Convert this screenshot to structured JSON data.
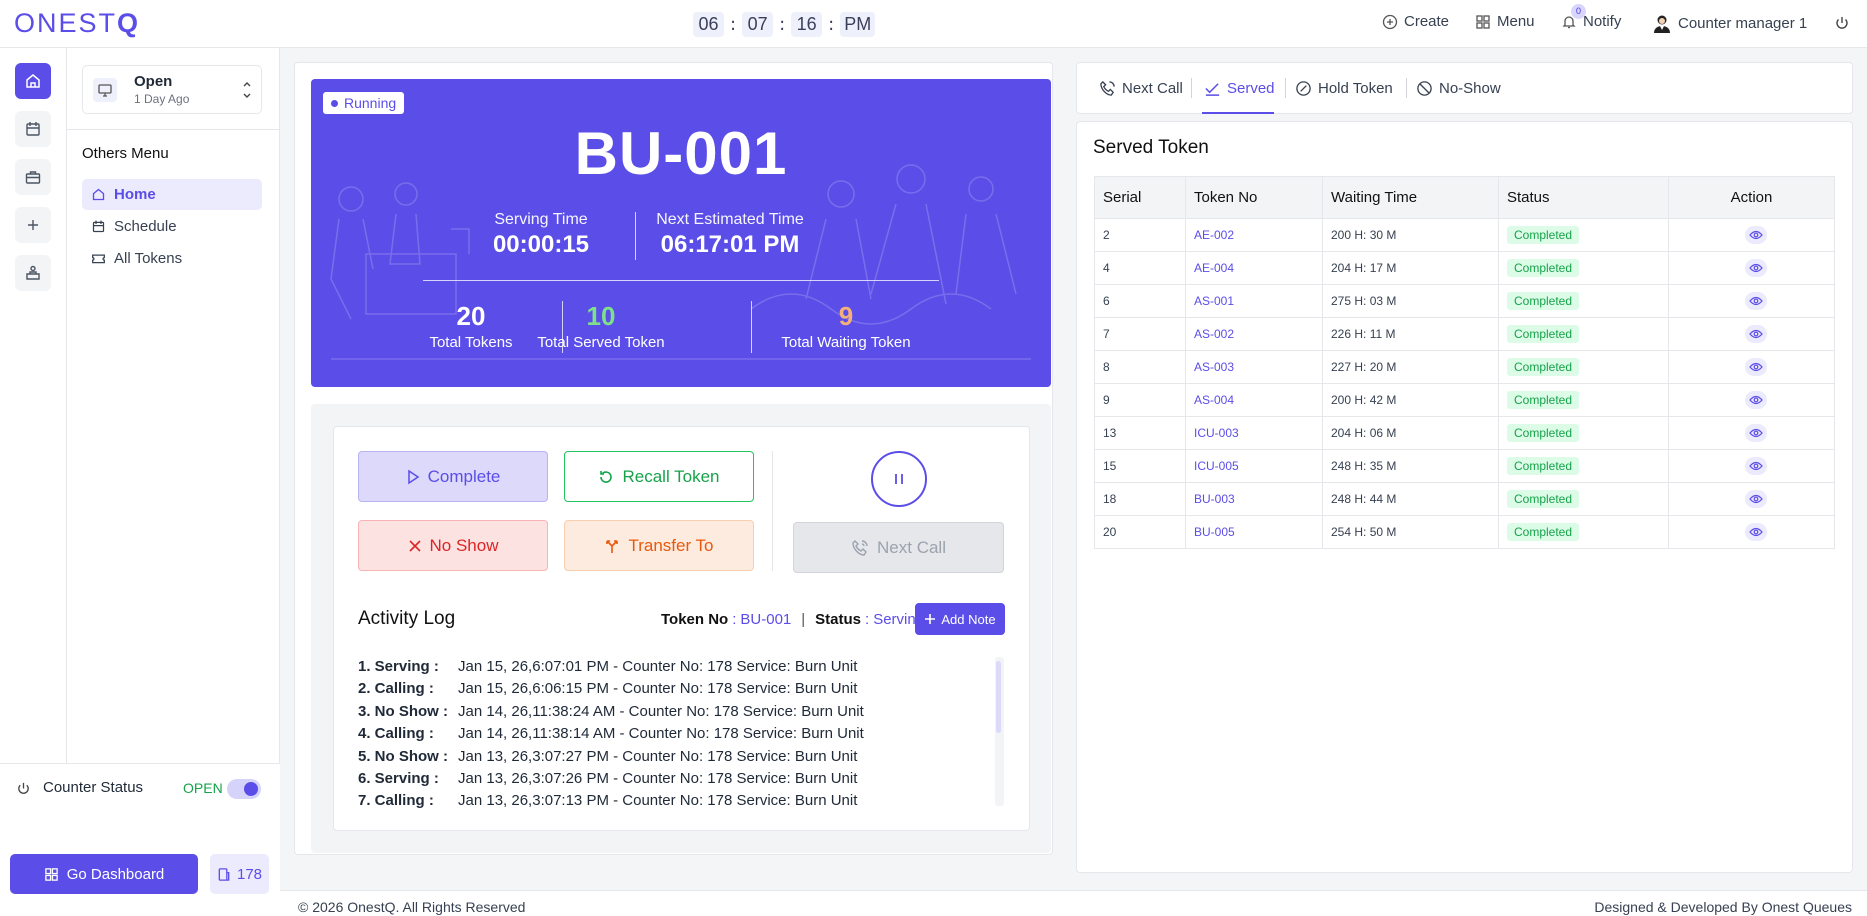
{
  "header": {
    "logo_text": "ONESTQ",
    "clock": {
      "hours": "06",
      "minutes": "07",
      "seconds": "16",
      "period": "PM"
    },
    "create_label": "Create",
    "menu_label": "Menu",
    "notify_label": "Notify",
    "notify_count": "0",
    "user_name": "Counter manager 1"
  },
  "sidebar": {
    "status_title": "Open",
    "status_sub": "1 Day Ago",
    "others_menu_title": "Others Menu",
    "items": [
      {
        "label": "Home",
        "icon": "home-icon"
      },
      {
        "label": "Schedule",
        "icon": "calendar-icon"
      },
      {
        "label": "All Tokens",
        "icon": "ticket-icon"
      }
    ],
    "counter_status_label": "Counter Status",
    "counter_status_value": "OPEN",
    "go_dashboard_label": "Go Dashboard",
    "counter_number": "178"
  },
  "hero": {
    "status_badge": "Running",
    "token": "BU-001",
    "serving_time_label": "Serving Time",
    "serving_time": "00:00:15",
    "next_estimated_label": "Next Estimated Time",
    "next_estimated": "06:17:01 PM",
    "stats": [
      {
        "value": "20",
        "label": "Total Tokens",
        "color": "#ffffff"
      },
      {
        "value": "10",
        "label": "Total Served Token",
        "color": "#7ee08a"
      },
      {
        "value": "9",
        "label": "Total Waiting Token",
        "color": "#f4b07a"
      }
    ]
  },
  "controls": {
    "complete_label": "Complete",
    "recall_label": "Recall Token",
    "noshow_label": "No Show",
    "transfer_label": "Transfer To",
    "nextcall_label": "Next Call"
  },
  "activity": {
    "title": "Activity Log",
    "token_no_label": "Token No",
    "token_no": "BU-001",
    "status_label": "Status",
    "status": "Serving",
    "add_note_label": "Add Note",
    "entries": [
      {
        "key": "1. Serving :",
        "text": "Jan 15, 26,6:07:01 PM - Counter No: 178 Service: Burn Unit"
      },
      {
        "key": "2. Calling :",
        "text": "Jan 15, 26,6:06:15 PM - Counter No: 178 Service: Burn Unit"
      },
      {
        "key": "3. No Show :",
        "text": "Jan 14, 26,11:38:24 AM - Counter No: 178 Service: Burn Unit"
      },
      {
        "key": "4. Calling :",
        "text": "Jan 14, 26,11:38:14 AM - Counter No: 178 Service: Burn Unit"
      },
      {
        "key": "5. No Show :",
        "text": "Jan 13, 26,3:07:27 PM - Counter No: 178 Service: Burn Unit"
      },
      {
        "key": "6. Serving :",
        "text": "Jan 13, 26,3:07:26 PM - Counter No: 178 Service: Burn Unit"
      },
      {
        "key": "7. Calling :",
        "text": "Jan 13, 26,3:07:13 PM - Counter No: 178 Service: Burn Unit"
      }
    ]
  },
  "tabs": [
    {
      "label": "Next Call",
      "icon": "phone-call-icon"
    },
    {
      "label": "Served",
      "icon": "check-icon"
    },
    {
      "label": "Hold Token",
      "icon": "hold-icon"
    },
    {
      "label": "No-Show",
      "icon": "ban-icon"
    }
  ],
  "served": {
    "title": "Served Token",
    "columns": [
      "Serial",
      "Token No",
      "Waiting Time",
      "Status",
      "Action"
    ],
    "rows": [
      {
        "serial": "2",
        "token": "AE-002",
        "wait": "200 H: 30 M",
        "status": "Completed"
      },
      {
        "serial": "4",
        "token": "AE-004",
        "wait": "204 H: 17 M",
        "status": "Completed"
      },
      {
        "serial": "6",
        "token": "AS-001",
        "wait": "275 H: 03 M",
        "status": "Completed"
      },
      {
        "serial": "7",
        "token": "AS-002",
        "wait": "226 H: 11 M",
        "status": "Completed"
      },
      {
        "serial": "8",
        "token": "AS-003",
        "wait": "227 H: 20 M",
        "status": "Completed"
      },
      {
        "serial": "9",
        "token": "AS-004",
        "wait": "200 H: 42 M",
        "status": "Completed"
      },
      {
        "serial": "13",
        "token": "ICU-003",
        "wait": "204 H: 06 M",
        "status": "Completed"
      },
      {
        "serial": "15",
        "token": "ICU-005",
        "wait": "248 H: 35 M",
        "status": "Completed"
      },
      {
        "serial": "18",
        "token": "BU-003",
        "wait": "248 H: 44 M",
        "status": "Completed"
      },
      {
        "serial": "20",
        "token": "BU-005",
        "wait": "254 H: 50 M",
        "status": "Completed"
      }
    ]
  },
  "footer": {
    "copyright": "© 2026 OnestQ. All Rights Reserved",
    "credit": "Designed & Developed By Onest Queues"
  },
  "colors": {
    "accent": "#5b4de8",
    "success": "#16a34a",
    "danger": "#dc2626",
    "warning": "#ea580c"
  }
}
